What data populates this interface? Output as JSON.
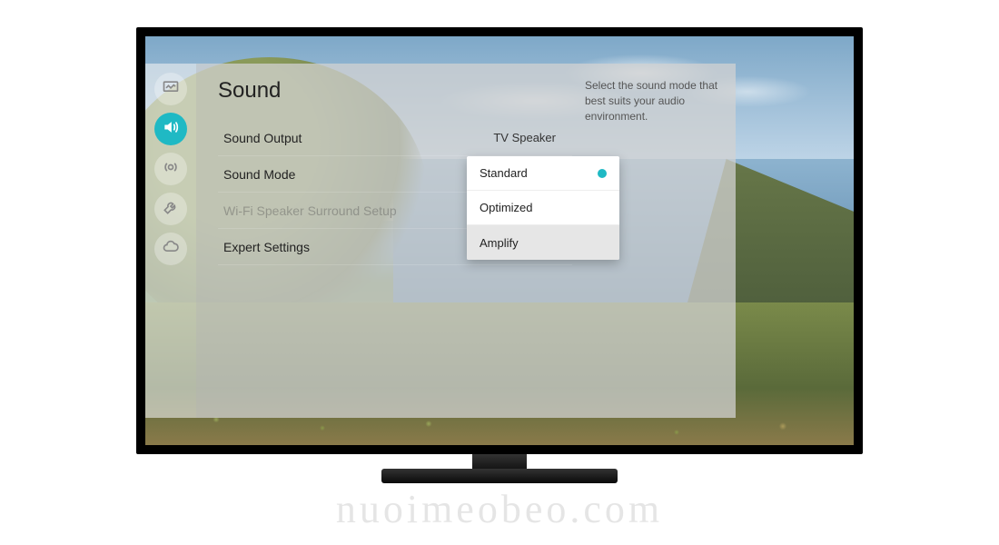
{
  "watermark": "nuoimeobeo.com",
  "rail": {
    "items": [
      {
        "name": "picture-icon"
      },
      {
        "name": "sound-icon"
      },
      {
        "name": "broadcast-icon"
      },
      {
        "name": "general-icon"
      },
      {
        "name": "support-icon"
      }
    ],
    "active_index": 1
  },
  "panel": {
    "title": "Sound",
    "rows": [
      {
        "label": "Sound Output",
        "value": "TV Speaker",
        "disabled": false
      },
      {
        "label": "Sound Mode",
        "value": "",
        "disabled": false
      },
      {
        "label": "Wi-Fi Speaker Surround Setup",
        "value": "",
        "disabled": true
      },
      {
        "label": "Expert Settings",
        "value": "",
        "disabled": false
      }
    ]
  },
  "dropdown": {
    "items": [
      {
        "label": "Standard",
        "selected": true,
        "highlight": false
      },
      {
        "label": "Optimized",
        "selected": false,
        "highlight": false
      },
      {
        "label": "Amplify",
        "selected": false,
        "highlight": true
      }
    ]
  },
  "help": {
    "text": "Select the sound mode that best suits your audio environment."
  }
}
